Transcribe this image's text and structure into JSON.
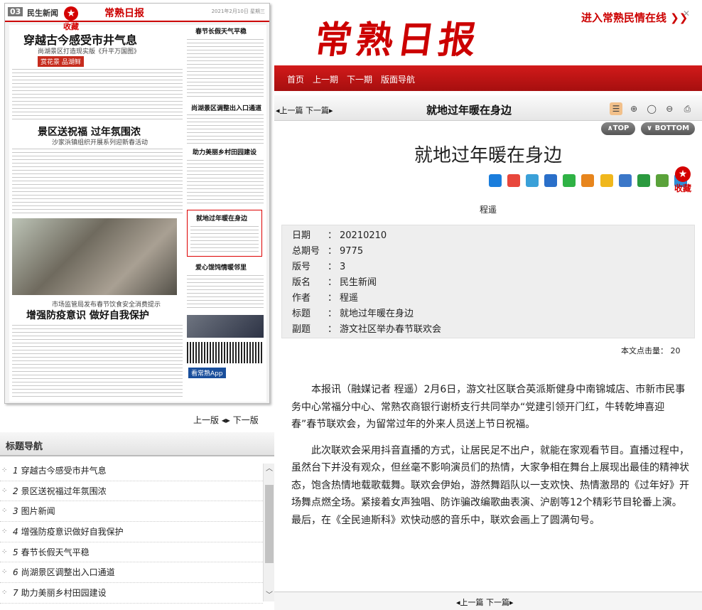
{
  "paper_preview": {
    "page_no": "03",
    "page_name": "民生新闻",
    "logo": "常熟日报",
    "date_line": "2021年2月10日 星期三",
    "favorite_label": "收藏",
    "headline_main": "穿越古今感受市井气息",
    "headline_main_sub": "尚湖景区打造现实版《升平万国图》",
    "headline_2": "景区送祝福 过年氛围浓",
    "headline_2_sub": "沙家浜镇组织开展系列迎新春活动",
    "headline_3": "增强防疫意识 做好自我保护",
    "headline_3_sub": "市场监管局发布春节饮食安全消费提示",
    "right_hl_1": "春节长假天气平稳",
    "right_hl_2": "尚湖景区调整出入口通道",
    "right_hl_3": "助力美丽乡村田园建设",
    "right_hl_4": "就地过年暖在身边",
    "right_hl_5": "爱心馄饨情暖邻里",
    "app_label": "看常熟App",
    "red_tag": "赏花景 品湖鲜"
  },
  "page_nav": {
    "prev": "上一版",
    "next": "下一版"
  },
  "title_nav": {
    "heading": "标题导航",
    "items": [
      {
        "num": "1",
        "label": "穿越古今感受市井气息"
      },
      {
        "num": "2",
        "label": "景区送祝福过年氛围浓"
      },
      {
        "num": "3",
        "label": "图片新闻"
      },
      {
        "num": "4",
        "label": "增强防疫意识做好自我保护"
      },
      {
        "num": "5",
        "label": "春节长假天气平稳"
      },
      {
        "num": "6",
        "label": "尚湖景区调整出入口通道"
      },
      {
        "num": "7",
        "label": "助力美丽乡村田园建设"
      }
    ]
  },
  "masthead": {
    "logo": "常熟日报",
    "enter_link": "进入常熟民情在线 ❯❯"
  },
  "topnav": {
    "home": "首页",
    "prev_issue": "上一期",
    "next_issue": "下一期",
    "layout_nav": "版面导航"
  },
  "article_bar": {
    "prev": "上一篇",
    "next": "下一篇",
    "title": "就地过年暖在身边"
  },
  "buttons": {
    "top": "∧TOP",
    "bottom": "∨ BOTTOM"
  },
  "article": {
    "title": "就地过年暖在身边",
    "author": "程遥",
    "favorite_label": "收藏",
    "meta": {
      "date_k": "日期",
      "date_v": "20210210",
      "issue_k": "总期号",
      "issue_v": "9775",
      "page_k": "版号",
      "page_v": "3",
      "pname_k": "版名",
      "pname_v": "民生新闻",
      "author_k": "作者",
      "author_v": "程遥",
      "title_k": "标题",
      "title_v": "就地过年暖在身边",
      "sub_k": "副题",
      "sub_v": "游文社区举办春节联欢会"
    },
    "click_label": "本文点击量：",
    "click_count": "20",
    "paragraphs": [
      "本报讯（融媒记者 程遥）2月6日，游文社区联合英派斯健身中南锦城店、市新市民事务中心常福分中心、常熟农商银行谢桥支行共同举办“党建引领开门红，牛转乾坤喜迎春”春节联欢会，为留常过年的外来人员送上节日祝福。",
      "此次联欢会采用抖音直播的方式，让居民足不出户，就能在家观看节目。直播过程中，虽然台下并没有观众，但丝毫不影响演员们的热情，大家争相在舞台上展现出最佳的精神状态，饱含热情地载歌载舞。联欢会伊始，游然舞蹈队以一支欢快、热情激昂的《过年好》开场舞点燃全场。紧接着女声独唱、防诈骗改编歌曲表演、沪剧等12个精彩节目轮番上演。最后，在《全民迪斯科》欢快动感的音乐中，联欢会画上了圆满句号。"
    ]
  },
  "bottom_bar": {
    "prev": "上一篇",
    "next": "下一篇"
  },
  "colors": {
    "brand_red": "#c00000",
    "nav_red": "#c41414"
  }
}
